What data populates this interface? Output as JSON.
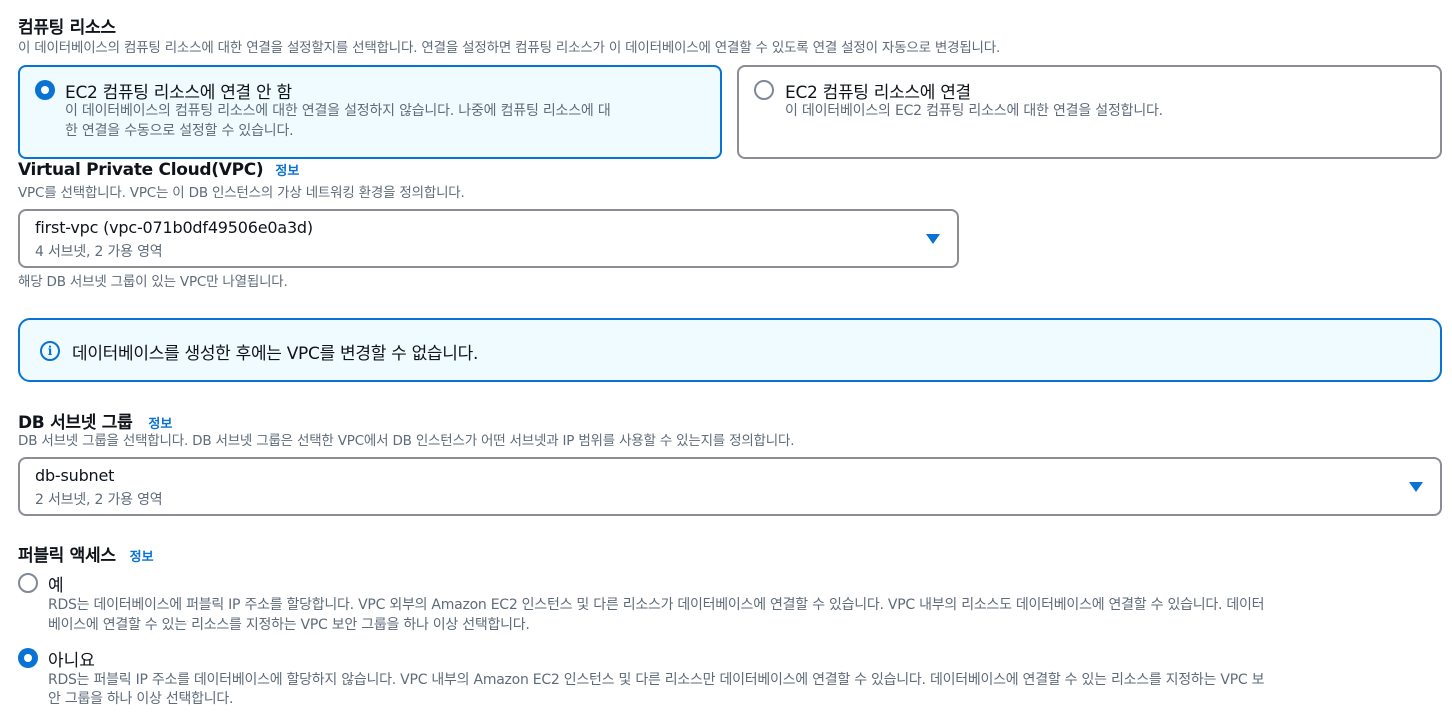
{
  "compute": {
    "title": "컴퓨팅 리소스",
    "description": "이 데이터베이스의 컴퓨팅 리소스에 대한 연결을 설정할지를 선택합니다. 연결을 설정하면 컴퓨팅 리소스가 이 데이터베이스에 연결할 수 있도록 연결 설정이 자동으로 변경됩니다.",
    "options": [
      {
        "label": "EC2 컴퓨팅 리소스에 연결 안 함",
        "desc_line1": "이 데이터베이스의 컴퓨팅 리소스에 대한 연결을 설정하지 않습니다. 나중에 컴퓨팅 리소스에 대",
        "desc_line2": "한 연결을 수동으로 설정할 수 있습니다.",
        "selected": true
      },
      {
        "label": "EC2 컴퓨팅 리소스에 연결",
        "desc_line1": "이 데이터베이스의 EC2 컴퓨팅 리소스에 대한 연결을 설정합니다.",
        "selected": false
      }
    ]
  },
  "vpc": {
    "title": "Virtual Private Cloud(VPC)",
    "info": "정보",
    "description": "VPC를 선택합니다. VPC는 이 DB 인스턴스의 가상 네트워킹 환경을 정의합니다.",
    "selected_value": "first-vpc (vpc-071b0df49506e0a3d)",
    "selected_sub": "4 서브넷, 2 가용 영역",
    "hint": "해당 DB 서브넷 그룹이 있는 VPC만 나열됩니다."
  },
  "alert": {
    "icon": "info-icon",
    "text": "데이터베이스를 생성한 후에는 VPC를 변경할 수 없습니다."
  },
  "subnet": {
    "title": "DB 서브넷 그룹",
    "info": "정보",
    "description": "DB 서브넷 그룹을 선택합니다. DB 서브넷 그룹은 선택한 VPC에서 DB 인스턴스가 어떤 서브넷과 IP 범위를 사용할 수 있는지를 정의합니다.",
    "selected_value": "db-subnet",
    "selected_sub": "2 서브넷, 2 가용 영역"
  },
  "public_access": {
    "title": "퍼블릭 액세스",
    "info": "정보",
    "options": [
      {
        "label": "예",
        "desc_line1": "RDS는 데이터베이스에 퍼블릭 IP 주소를 할당합니다. VPC 외부의 Amazon EC2 인스턴스 및 다른 리소스가 데이터베이스에 연결할 수 있습니다. VPC 내부의 리소스도 데이터베이스에 연결할 수 있습니다. 데이터",
        "desc_line2": "베이스에 연결할 수 있는 리소스를 지정하는 VPC 보안 그룹을 하나 이상 선택합니다.",
        "selected": false
      },
      {
        "label": "아니요",
        "desc_line1": "RDS는 퍼블릭 IP 주소를 데이터베이스에 할당하지 않습니다. VPC 내부의 Amazon EC2 인스턴스 및 다른 리소스만 데이터베이스에 연결할 수 있습니다. 데이터베이스에 연결할 수 있는 리소스를 지정하는 VPC 보",
        "desc_line2": "안 그룹을 하나 이상 선택합니다.",
        "selected": true
      }
    ]
  },
  "colors": {
    "accent": "#0972d3",
    "selected_bg": "#f0fbff",
    "border": "#8c8c94",
    "secondary_text": "#5f6b7a"
  }
}
